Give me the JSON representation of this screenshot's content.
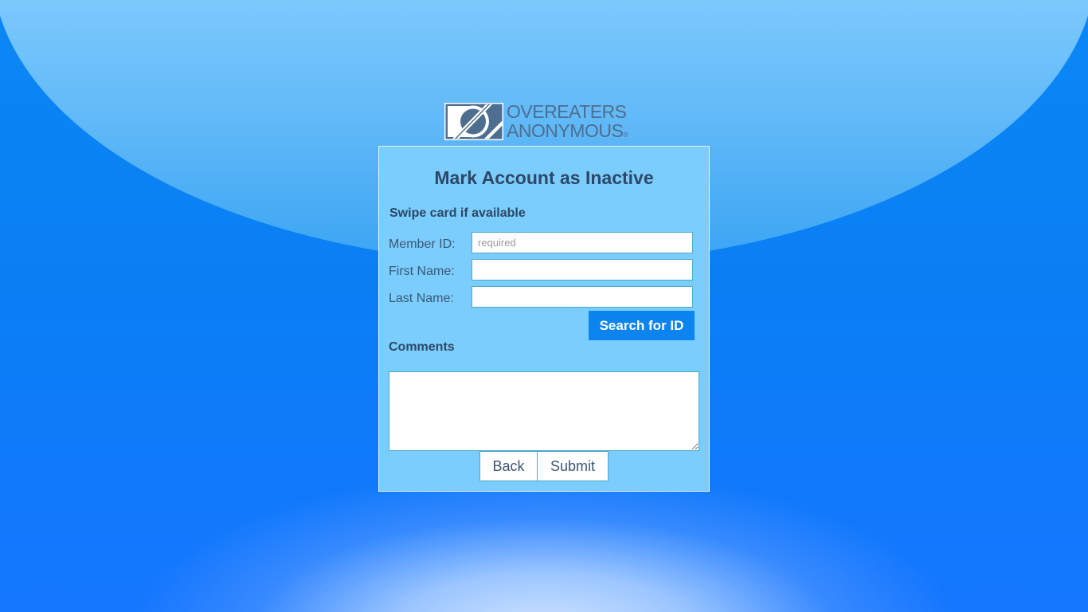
{
  "logo": {
    "line1": "OVEREATERS",
    "line2": "ANONYMOUS",
    "reg": "®",
    "icon": "oa-logo-icon"
  },
  "form": {
    "title": "Mark Account as Inactive",
    "swipe_text": "Swipe card if available",
    "member_id_label": "Member ID:",
    "member_id_placeholder": "required",
    "member_id_value": "",
    "first_name_label": "First Name:",
    "first_name_value": "",
    "last_name_label": "Last Name:",
    "last_name_value": "",
    "search_button": "Search for ID",
    "comments_label": "Comments",
    "comments_value": "",
    "back_button": "Back",
    "submit_button": "Submit"
  },
  "colors": {
    "panel": "#7bcdfd",
    "accent": "#0c84f0",
    "text": "#2d4766"
  }
}
